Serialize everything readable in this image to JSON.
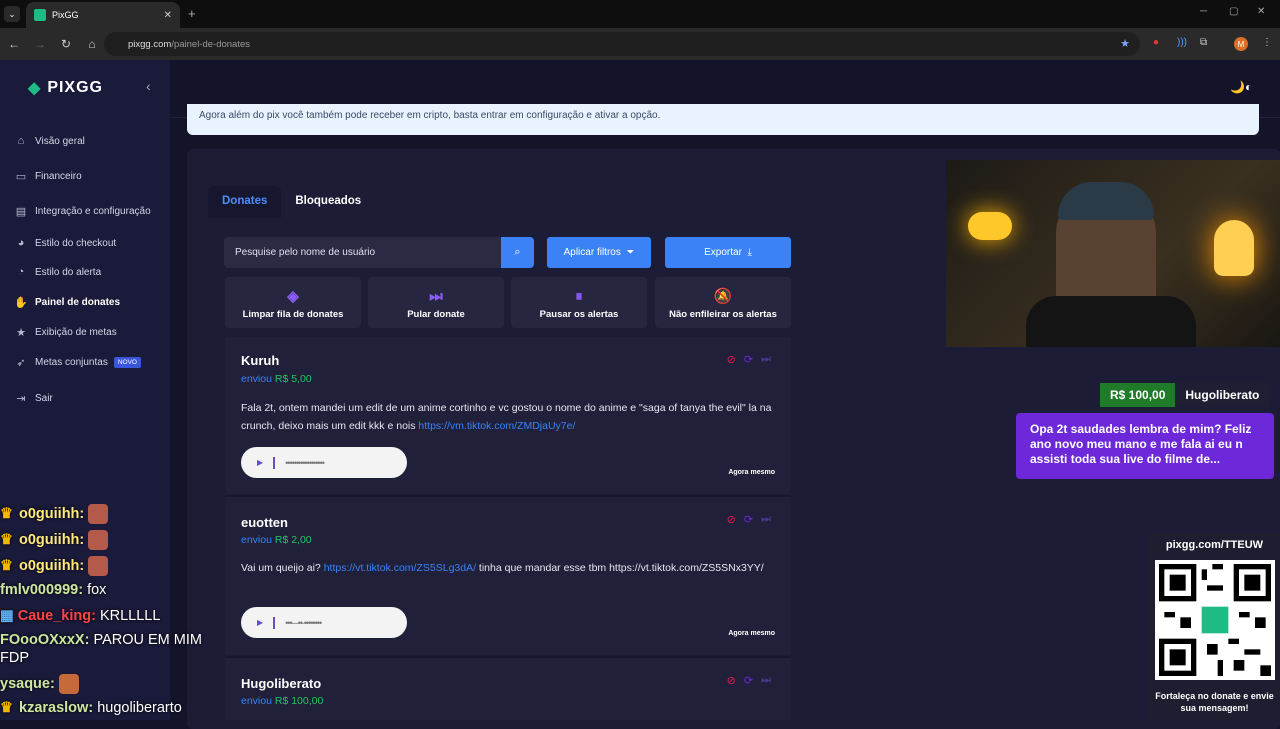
{
  "browser": {
    "tab_title": "PixGG",
    "url_domain": "pixgg.com",
    "url_path": "/painel-de-donates",
    "profile_initial": "M"
  },
  "sidebar": {
    "logo": "PIXGG",
    "items": [
      {
        "label": "Visão geral",
        "icon": "home-icon"
      },
      {
        "label": "Financeiro",
        "icon": "wallet-icon"
      },
      {
        "label": "Integração e configuração",
        "icon": "settings-icon"
      },
      {
        "label": "Estilo do checkout",
        "icon": "palette-icon"
      },
      {
        "label": "Estilo do alerta",
        "icon": "alert-style-icon"
      },
      {
        "label": "Painel de donates",
        "icon": "donate-panel-icon",
        "active": true
      },
      {
        "label": "Exibição de metas",
        "icon": "star-icon"
      },
      {
        "label": "Metas conjuntas",
        "icon": "rocket-icon",
        "badge": "NOVO"
      },
      {
        "label": "Sair",
        "icon": "logout-icon"
      }
    ]
  },
  "banner": {
    "text": "Agora além do pix você também pode receber em cripto, basta entrar em configuração e ativar a opção."
  },
  "tabs": [
    {
      "label": "Donates"
    },
    {
      "label": "Bloqueados"
    }
  ],
  "filters": {
    "search_placeholder": "Pesquise pelo nome de usuário",
    "apply_label": "Aplicar filtros",
    "export_label": "Exportar"
  },
  "actions": [
    {
      "label": "Limpar fila de donates"
    },
    {
      "label": "Pular donate"
    },
    {
      "label": "Pausar os alertas"
    },
    {
      "label": "Não enfileirar os alertas"
    }
  ],
  "donates": [
    {
      "name": "Kuruh",
      "sent_label": "enviou",
      "amount": "R$ 5,00",
      "message": "Fala 2t, ontem mandei um edit de um anime cortinho e vc gostou o nome do anime e \"saga of tanya the evil\" la na crunch, deixo mais um edit kkk e nois ",
      "link": "https://vm.tiktok.com/ZMDjaUy7e/",
      "time": "Agora mesmo"
    },
    {
      "name": "euotten",
      "sent_label": "enviou",
      "amount": "R$ 2,00",
      "message_pre": "Vai um queijo ai? ",
      "link": "https://vt.tiktok.com/ZS5SLg3dA/",
      "message_post": " tinha que mandar esse tbm https://vt.tiktok.com/ZS5SNx3YY/",
      "time": "Agora mesmo"
    },
    {
      "name": "Hugoliberato",
      "sent_label": "enviou",
      "amount": "R$ 100,00"
    }
  ],
  "overlay": {
    "donation_amount": "R$ 100,00",
    "donation_name": "Hugoliberato",
    "donation_message": "Opa 2t saudades lembra de mim? Feliz ano novo meu mano e me fala ai eu n assisti toda sua live do filme de...",
    "qr_title": "pixgg.com/TTEUW",
    "qr_caption": "Fortaleça no donate e envie sua mensagem!"
  },
  "chat": [
    {
      "user": "o0guiihh:",
      "msg": ""
    },
    {
      "user": "o0guiihh:",
      "msg": ""
    },
    {
      "user": "o0guiihh:",
      "msg": ""
    },
    {
      "user": "fmlv000999:",
      "msg": "fox"
    },
    {
      "user": "Caue_king:",
      "msg": "KRLLLLL"
    },
    {
      "user": "FOooOXxxX:",
      "msg": "PAROU EM MIM"
    },
    {
      "user": "",
      "msg": "FDP"
    },
    {
      "user": "ysaque:",
      "msg": ""
    },
    {
      "user": "kzaraslow:",
      "msg": "hugoliberarto"
    }
  ],
  "colors": {
    "accent": "#3b82f6",
    "green": "#22c55e",
    "purple": "#6d28d9",
    "sidebar": "#1a1a3a"
  }
}
